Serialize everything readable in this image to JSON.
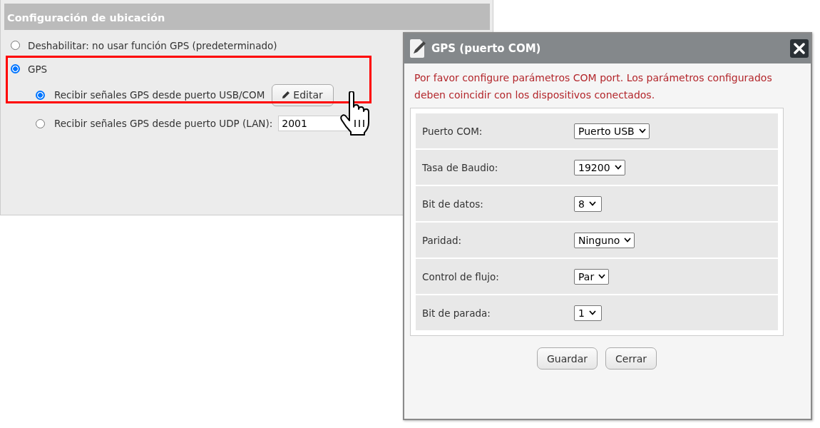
{
  "location_settings": {
    "title": "Configuración de ubicación",
    "options": [
      {
        "label": "Deshabilitar: no usar función GPS (predeterminado)",
        "selected": false
      },
      {
        "label": "GPS",
        "selected": true,
        "children": [
          {
            "label": "Recibir señales GPS desde puerto USB/COM",
            "selected": true,
            "button": "Editar"
          },
          {
            "label": "Recibir señales GPS desde puerto UDP (LAN):",
            "selected": false,
            "value": "2001"
          }
        ]
      }
    ]
  },
  "dialog": {
    "title": "GPS (puerto COM)",
    "message": "Por favor configure parámetros COM port. Los parámetros configurados deben coincidir con los dispositivos conectados.",
    "fields": [
      {
        "label": "Puerto COM:",
        "value": "Puerto USB"
      },
      {
        "label": "Tasa de Baudio:",
        "value": "19200"
      },
      {
        "label": "Bit de datos:",
        "value": "8"
      },
      {
        "label": "Paridad:",
        "value": "Ninguno"
      },
      {
        "label": "Control de flujo:",
        "value": "Par"
      },
      {
        "label": "Bit de parada:",
        "value": "1"
      }
    ],
    "buttons": [
      "Guardar",
      "Cerrar"
    ]
  }
}
